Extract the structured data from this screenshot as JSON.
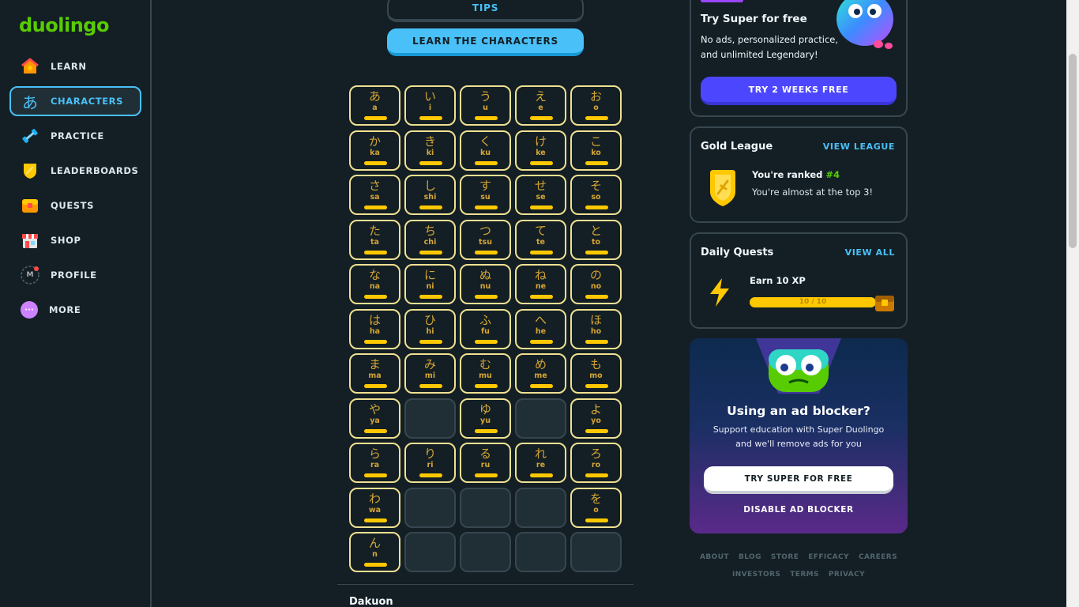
{
  "brand": {
    "logo_text": "duolingo"
  },
  "sidebar": {
    "items": [
      {
        "label": "LEARN",
        "icon": "house-icon"
      },
      {
        "label": "CHARACTERS",
        "icon": "hiragana-a-icon",
        "glyph": "あ"
      },
      {
        "label": "PRACTICE",
        "icon": "dumbbell-icon"
      },
      {
        "label": "LEADERBOARDS",
        "icon": "shield-icon"
      },
      {
        "label": "QUESTS",
        "icon": "treasure-chest-icon"
      },
      {
        "label": "SHOP",
        "icon": "shop-icon"
      },
      {
        "label": "PROFILE",
        "icon": "avatar-icon",
        "avatar_letter": "M"
      },
      {
        "label": "MORE",
        "icon": "more-dots-icon",
        "glyph": "···"
      }
    ]
  },
  "main": {
    "tips_label": "TIPS",
    "learn_label": "LEARN THE CHARACTERS",
    "kana_rows": [
      [
        {
          "k": "あ",
          "r": "a"
        },
        {
          "k": "い",
          "r": "i"
        },
        {
          "k": "う",
          "r": "u"
        },
        {
          "k": "え",
          "r": "e"
        },
        {
          "k": "お",
          "r": "o"
        }
      ],
      [
        {
          "k": "か",
          "r": "ka"
        },
        {
          "k": "き",
          "r": "ki"
        },
        {
          "k": "く",
          "r": "ku"
        },
        {
          "k": "け",
          "r": "ke"
        },
        {
          "k": "こ",
          "r": "ko"
        }
      ],
      [
        {
          "k": "さ",
          "r": "sa"
        },
        {
          "k": "し",
          "r": "shi"
        },
        {
          "k": "す",
          "r": "su"
        },
        {
          "k": "せ",
          "r": "se"
        },
        {
          "k": "そ",
          "r": "so"
        }
      ],
      [
        {
          "k": "た",
          "r": "ta"
        },
        {
          "k": "ち",
          "r": "chi"
        },
        {
          "k": "つ",
          "r": "tsu"
        },
        {
          "k": "て",
          "r": "te"
        },
        {
          "k": "と",
          "r": "to"
        }
      ],
      [
        {
          "k": "な",
          "r": "na"
        },
        {
          "k": "に",
          "r": "ni"
        },
        {
          "k": "ぬ",
          "r": "nu"
        },
        {
          "k": "ね",
          "r": "ne"
        },
        {
          "k": "の",
          "r": "no"
        }
      ],
      [
        {
          "k": "は",
          "r": "ha"
        },
        {
          "k": "ひ",
          "r": "hi"
        },
        {
          "k": "ふ",
          "r": "fu"
        },
        {
          "k": "へ",
          "r": "he"
        },
        {
          "k": "ほ",
          "r": "ho"
        }
      ],
      [
        {
          "k": "ま",
          "r": "ma"
        },
        {
          "k": "み",
          "r": "mi"
        },
        {
          "k": "む",
          "r": "mu"
        },
        {
          "k": "め",
          "r": "me"
        },
        {
          "k": "も",
          "r": "mo"
        }
      ],
      [
        {
          "k": "や",
          "r": "ya"
        },
        null,
        {
          "k": "ゆ",
          "r": "yu"
        },
        null,
        {
          "k": "よ",
          "r": "yo"
        }
      ],
      [
        {
          "k": "ら",
          "r": "ra"
        },
        {
          "k": "り",
          "r": "ri"
        },
        {
          "k": "る",
          "r": "ru"
        },
        {
          "k": "れ",
          "r": "re"
        },
        {
          "k": "ろ",
          "r": "ro"
        }
      ],
      [
        {
          "k": "わ",
          "r": "wa"
        },
        null,
        null,
        null,
        {
          "k": "を",
          "r": "o"
        }
      ],
      [
        {
          "k": "ん",
          "r": "n"
        },
        null,
        null,
        null,
        null
      ]
    ],
    "next_section_title": "Dakuon"
  },
  "right": {
    "super": {
      "title": "Try Super for free",
      "description": "No ads, personalized practice, and unlimited Legendary!",
      "button": "TRY 2 WEEKS FREE"
    },
    "league": {
      "title": "Gold League",
      "link": "VIEW LEAGUE",
      "rank_prefix": "You're ranked ",
      "rank_value": "#4",
      "subtext": "You're almost at the top 3!"
    },
    "quests": {
      "title": "Daily Quests",
      "link": "VIEW ALL",
      "quest_name": "Earn 10 XP",
      "progress_text": "10 / 10",
      "progress_fraction": 1.0
    },
    "adblock": {
      "title": "Using an ad blocker?",
      "description": "Support education with Super Duolingo and we'll remove ads for you",
      "primary_button": "TRY SUPER FOR FREE",
      "secondary_button": "DISABLE AD BLOCKER"
    },
    "footer": {
      "row1": [
        "ABOUT",
        "BLOG",
        "STORE",
        "EFFICACY",
        "CAREERS"
      ],
      "row2": [
        "INVESTORS",
        "TERMS",
        "PRIVACY"
      ]
    }
  },
  "colors": {
    "background": "#131f24",
    "accent_blue": "#49c0f8",
    "brand_green": "#58cc02",
    "gold": "#ffc800",
    "super_purple": "#4c47ff"
  }
}
